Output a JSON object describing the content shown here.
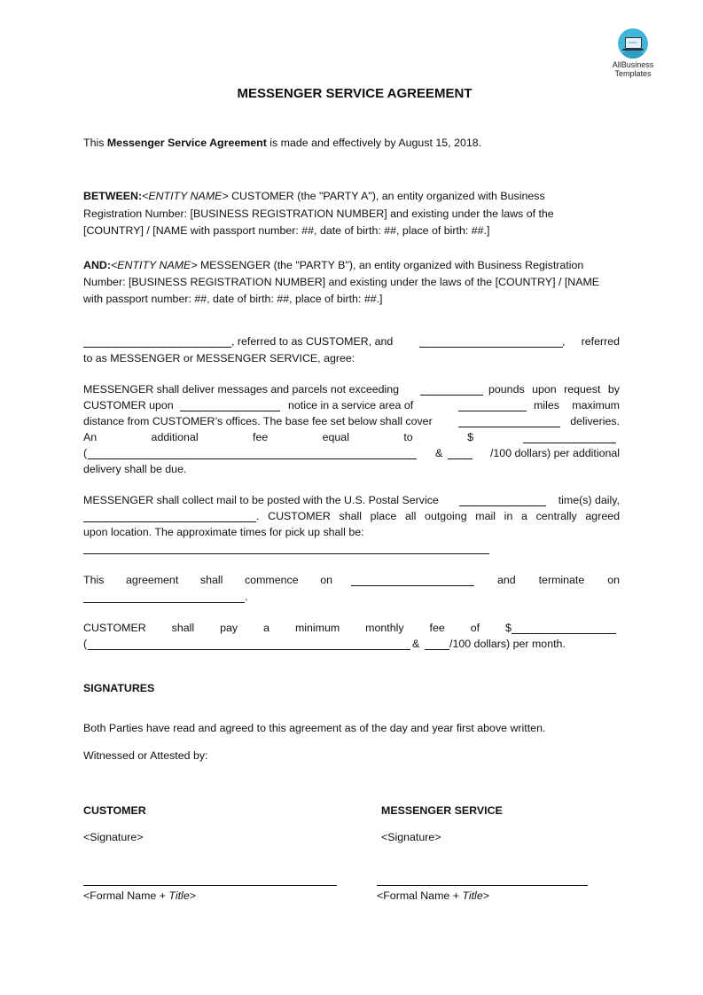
{
  "logo": {
    "icon": "laptop-icon",
    "line1": "AllBusiness",
    "line2": "Templates",
    "color": "#41b6d9"
  },
  "title": "MESSENGER SERVICE AGREEMENT",
  "intro": {
    "prefix": "This ",
    "bold": "Messenger Service Agreement",
    "suffix": " is made and effectively by August 15, 2018."
  },
  "between": {
    "label": "BETWEEN:",
    "entity": "<ENTITY NAME>",
    "line1_rest": " CUSTOMER (the \"PARTY A\"), an entity organized with Business",
    "line2": "Registration Number: [BUSINESS REGISTRATION NUMBER] and existing under the laws of the",
    "line3": "[COUNTRY] / [NAME with passport number: ##, date of birth: ##, place of birth: ##.]"
  },
  "and": {
    "label": "AND:",
    "entity": "<ENTITY NAME>",
    "line1_rest": " MESSENGER (the \"PARTY B\"), an entity organized with Business Registration",
    "line2": "Number: [BUSINESS REGISTRATION NUMBER] and existing under the laws of the [COUNTRY] / [NAME",
    "line3": "with passport number: ##, date of birth: ##, place of birth: ##.]"
  },
  "referred": {
    "part1": ",   referred to as CUSTOMER, and",
    "part2": ",   referred",
    "line2": "to as MESSENGER or MESSENGER SERVICE, agree:"
  },
  "deliver": {
    "l1a": "MESSENGER shall deliver messages and parcels not exceeding",
    "l1b": "pounds upon request by",
    "l2a": "CUSTOMER upon",
    "l2b": "notice in a service area of",
    "l2c": "miles maximum",
    "l3a": "distance from CUSTOMER’s offices. The base fee set below shall cover",
    "l3b": "deliveries.",
    "l4": [
      "An",
      "additional",
      "fee",
      "equal",
      "to",
      "$"
    ],
    "l5a": "(",
    "l5b": "&",
    "l5c": "/100  dollars) per additional",
    "l6": "delivery shall be due."
  },
  "collect": {
    "l1a": "MESSENGER shall collect mail to be posted with the U.S. Postal Service",
    "l1b": "time(s) daily,",
    "l2": ".   CUSTOMER shall place all outgoing mail in a centrally agreed",
    "l3": "upon location. The approximate times for pick up shall be:",
    "l4_dashes": "____"
  },
  "term": {
    "l1": [
      "This",
      "agreement",
      "shall",
      "commence",
      "on"
    ],
    "l1b": [
      "and",
      "terminate",
      "on"
    ],
    "l2": "."
  },
  "fee": {
    "l1": [
      "CUSTOMER",
      "shall",
      "pay",
      "a",
      "minimum",
      "monthly",
      "fee",
      "of",
      "$"
    ],
    "l2a": "(",
    "l2b": "&",
    "l2c": "/100 dollars) per month."
  },
  "signatures": {
    "heading": "SIGNATURES",
    "statement": "Both Parties have read and agreed to this agreement as of the day and year first above written.",
    "witness": "Witnessed or Attested by:",
    "columns": [
      {
        "party": "CUSTOMER",
        "signature": "<Signature>",
        "name_prefix": "<Formal Name + ",
        "name_title": "Title",
        "name_suffix": ">"
      },
      {
        "party": "MESSENGER SERVICE",
        "signature": "<Signature>",
        "name_prefix": "<Formal Name + ",
        "name_title": "Title",
        "name_suffix": ">"
      }
    ]
  }
}
